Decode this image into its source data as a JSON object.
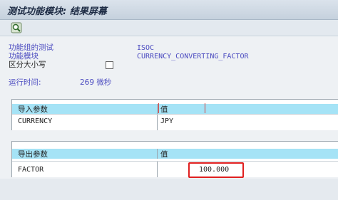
{
  "window": {
    "title": "测试功能模块: 结果屏幕"
  },
  "toolbar": {
    "icon": "magnifier-refresh-icon"
  },
  "info": {
    "function_group_label": "功能组的测试",
    "function_group_value": "ISOC",
    "function_module_label": "功能模块",
    "function_module_value": "CURRENCY_CONVERTING_FACTOR",
    "case_sensitive_label": "区分大小写",
    "case_sensitive_checked": false,
    "runtime_label": "运行时间:",
    "runtime_value": "269 微秒"
  },
  "import_table": {
    "col1_header": "导入参数",
    "col2_header": "值",
    "rows": [
      {
        "param": "CURRENCY",
        "value": "JPY"
      }
    ]
  },
  "export_table": {
    "col1_header": "导出参数",
    "col2_header": "值",
    "rows": [
      {
        "param": "FACTOR",
        "value": "100.000"
      }
    ]
  },
  "colors": {
    "header_fill": "#a5e3f6",
    "highlight": "#e02020",
    "label_text": "#4b4bc0"
  }
}
